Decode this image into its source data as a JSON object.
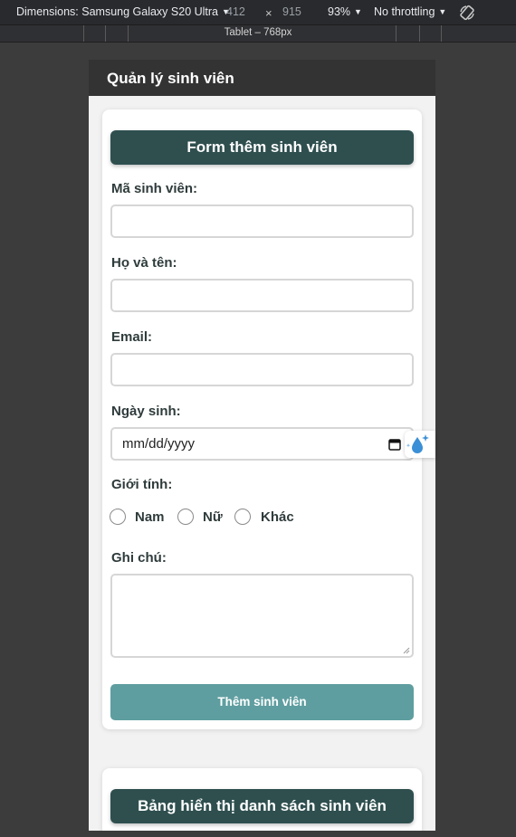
{
  "devtools": {
    "device_label": "Dimensions: Samsung Galaxy S20 Ultra",
    "width": "412",
    "times": "×",
    "height": "915",
    "zoom": "93%",
    "throttling": "No throttling",
    "breakpoint_label": "Tablet – 768px",
    "caret": "▼"
  },
  "app": {
    "header_title": "Quản lý sinh viên"
  },
  "form": {
    "title": "Form thêm sinh viên",
    "student_id_label": "Mã sinh viên:",
    "student_id_value": "",
    "full_name_label": "Họ và tên:",
    "full_name_value": "",
    "email_label": "Email:",
    "email_value": "",
    "dob_label": "Ngày sinh:",
    "dob_placeholder": "mm/dd/yyyy",
    "gender_label": "Giới tính:",
    "gender_options": [
      "Nam",
      "Nữ",
      "Khác"
    ],
    "note_label": "Ghi chú:",
    "note_value": "",
    "submit_label": "Thêm sinh viên"
  },
  "table_section": {
    "title": "Bảng hiển thị danh sách sinh viên"
  },
  "colors": {
    "header_bg": "#333333",
    "title_button_bg": "#2f4f4f",
    "submit_bg": "#5f9ea0",
    "page_bg": "#f2f2f2"
  },
  "icons": {
    "device_rotate": "rotate-icon",
    "calendar": "calendar-icon",
    "extension": "water-drop-sparkle-icon"
  }
}
